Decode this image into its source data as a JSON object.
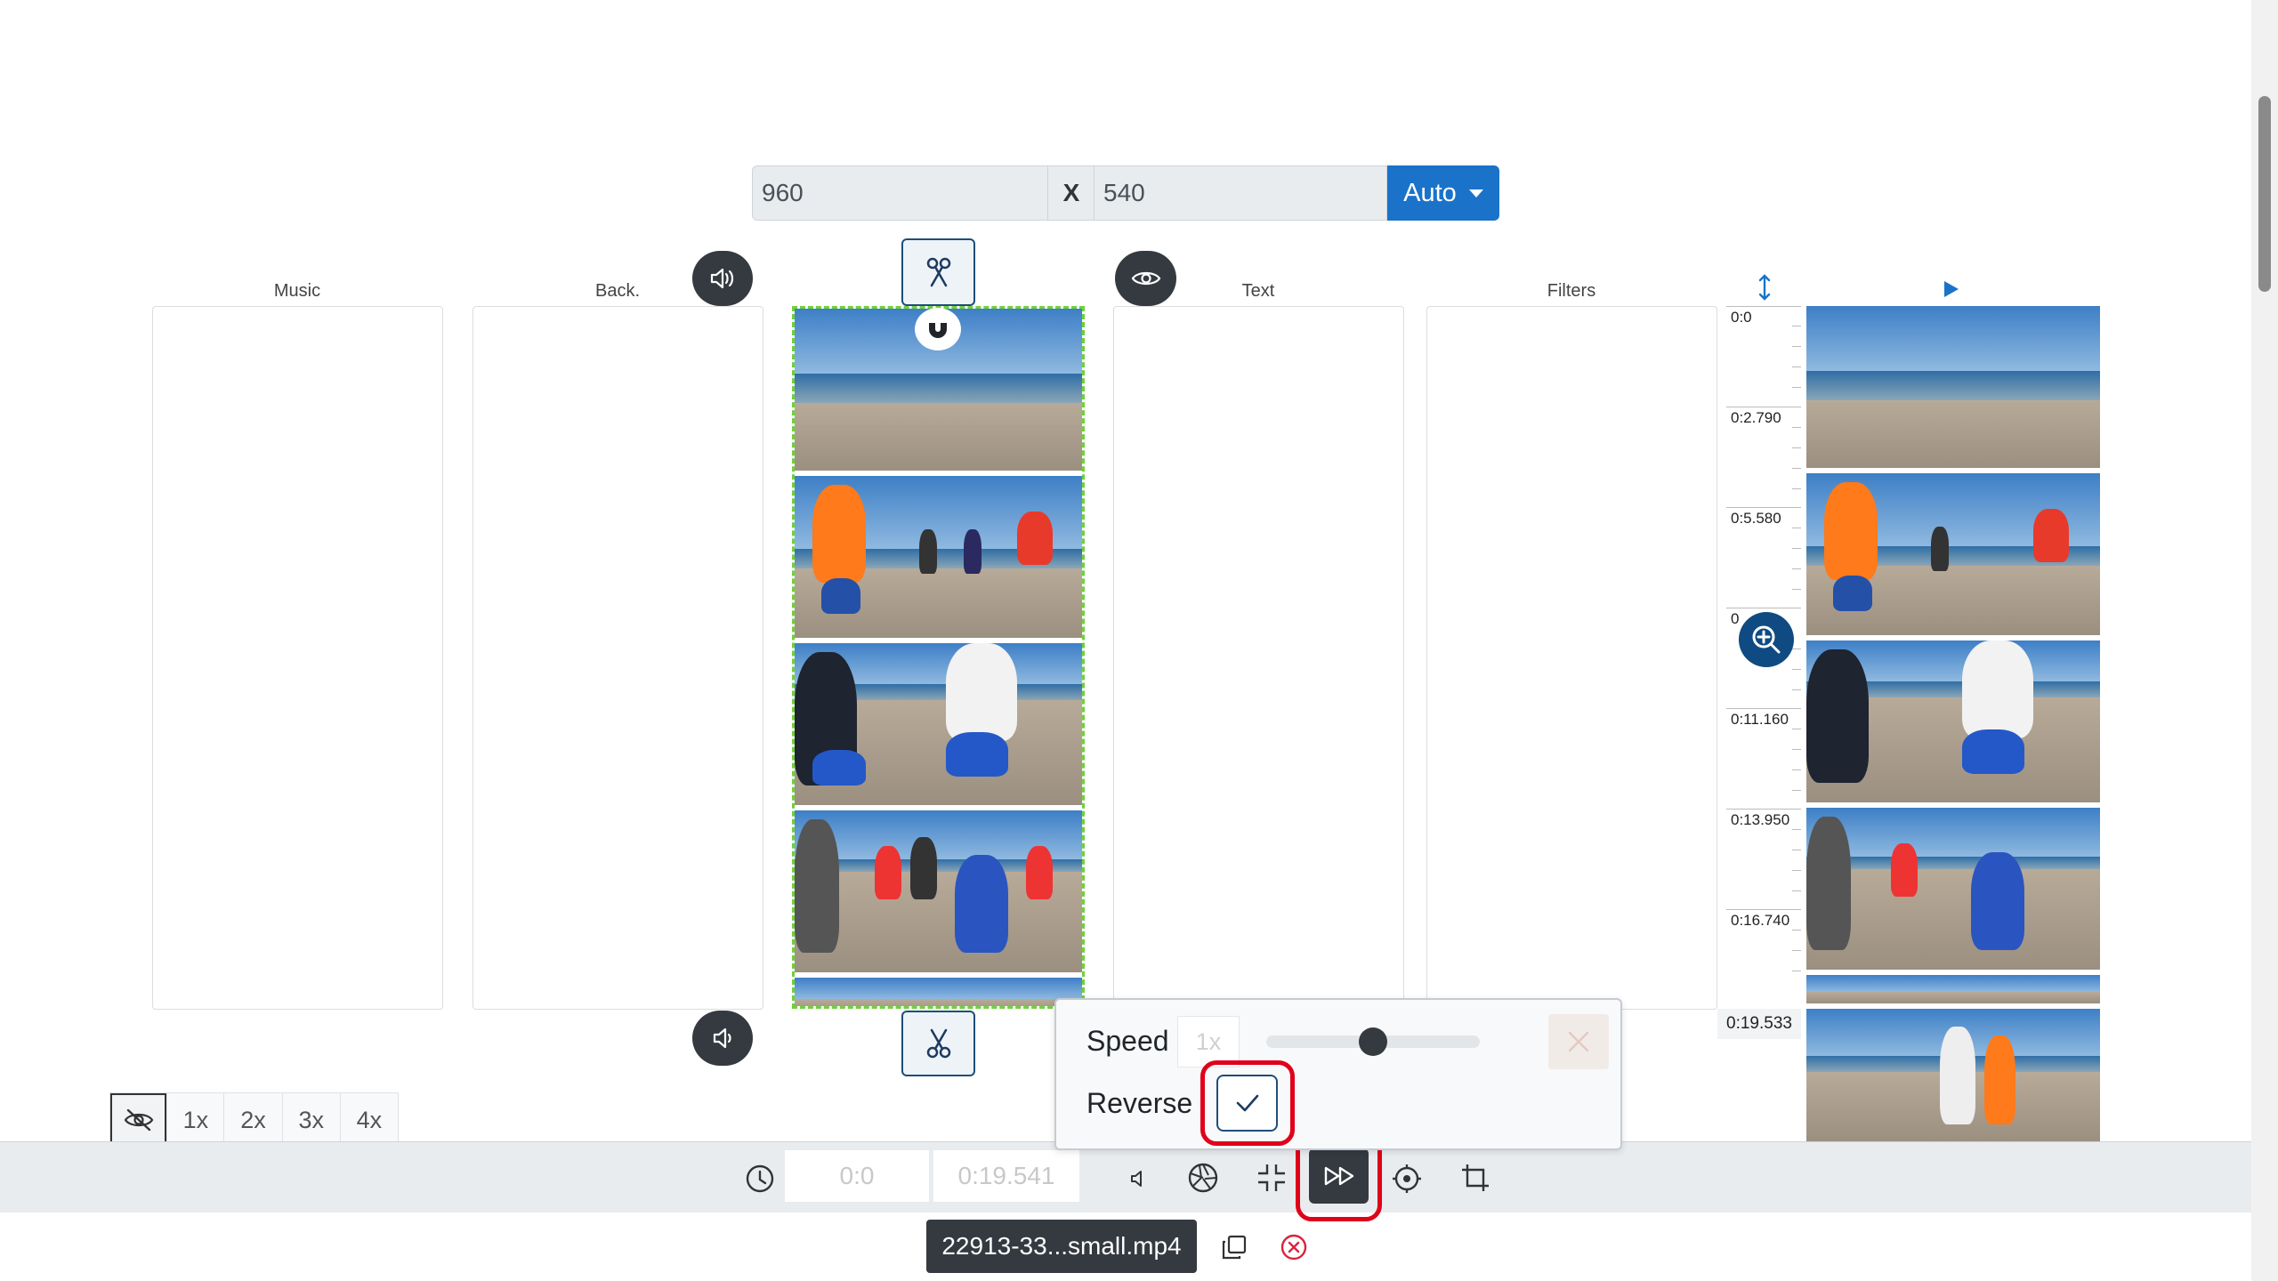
{
  "resolution": {
    "width": "960",
    "separator": "X",
    "height": "540",
    "mode_label": "Auto"
  },
  "tracks": {
    "music_label": "Music",
    "back_label": "Back.",
    "text_label": "Text",
    "filters_label": "Filters"
  },
  "ruler": {
    "marks": [
      "0:0",
      "0:2.790",
      "0:5.580",
      "0",
      "0:11.160",
      "0:13.950",
      "0:16.740"
    ],
    "end_label": "0:19.533"
  },
  "zoom": {
    "options": [
      "1x",
      "2x",
      "3x",
      "4x"
    ]
  },
  "speed_popover": {
    "speed_label": "Speed",
    "speed_value": "1x",
    "speed_level": 0.5,
    "reverse_label": "Reverse",
    "reverse_checked": true
  },
  "toolbar": {
    "start_time": "0:0",
    "end_time": "0:19.541"
  },
  "file": {
    "name": "22913-33...small.mp4"
  },
  "icons": {
    "volume_up": "volume-up-icon",
    "volume_down": "volume-down-icon",
    "scissors_top": "scissors-icon",
    "scissors_bottom": "scissors-icon",
    "magnet": "magnet-icon",
    "eye": "eye-icon",
    "resize": "vertical-resize-icon",
    "play": "play-icon",
    "zoom_in": "zoom-in-icon",
    "hide": "eye-slash-icon",
    "clock": "clock-icon",
    "speaker": "speaker-icon",
    "aperture": "aperture-icon",
    "compress": "compress-icon",
    "fast_forward": "fast-forward-icon",
    "target": "target-icon",
    "crop": "crop-icon",
    "copy": "copy-icon",
    "remove": "remove-circle-icon"
  },
  "colors": {
    "accent": "#1a73c9",
    "highlight": "#e0001a",
    "clip_border": "#6fd13a",
    "dark": "#343a40"
  }
}
